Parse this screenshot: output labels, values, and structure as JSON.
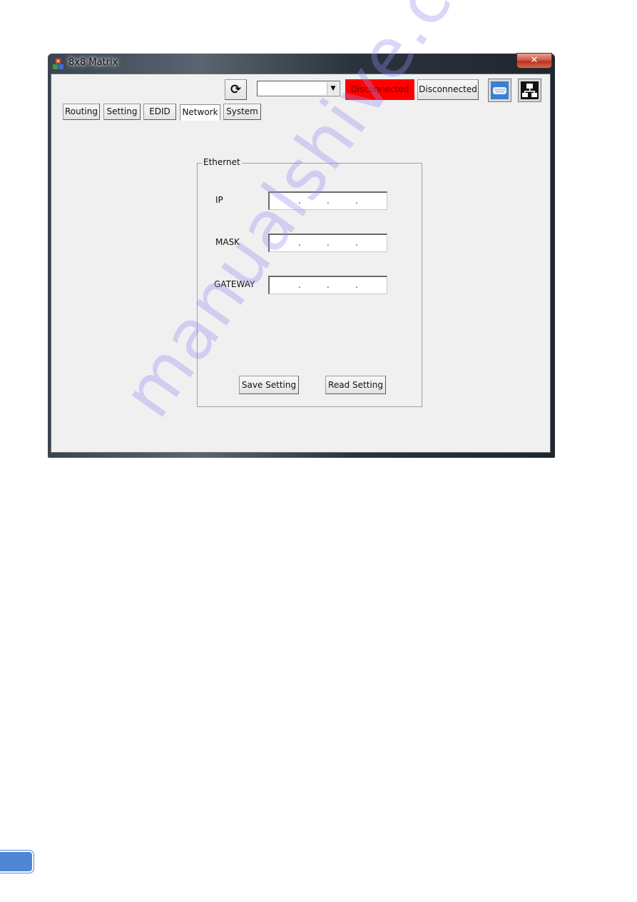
{
  "window": {
    "title": "8x8 Matrix",
    "close_label": "✕"
  },
  "toolbar": {
    "refresh_icon": "⟳",
    "port_select_value": "",
    "combo_arrow": "▼",
    "status_indicator": "Disconnected",
    "status_indicator_color": "#ff0000",
    "connect_button": "Disconnected",
    "serial_icon": "serial-port-icon",
    "network_icon": "network-icon"
  },
  "tabs": [
    {
      "label": "Routing",
      "active": false
    },
    {
      "label": "Setting",
      "active": false
    },
    {
      "label": "EDID",
      "active": false
    },
    {
      "label": "Network",
      "active": true
    },
    {
      "label": "System",
      "active": false
    }
  ],
  "ethernet": {
    "title": "Ethernet",
    "fields": [
      {
        "label": "IP",
        "value": " .  .  . "
      },
      {
        "label": "MASK",
        "value": " .  .  . "
      },
      {
        "label": "GATEWAY",
        "value": " .  .  . "
      }
    ],
    "ip_separator": ".",
    "save_button": "Save Setting",
    "read_button": "Read Setting"
  },
  "watermark": "manualshive.com"
}
